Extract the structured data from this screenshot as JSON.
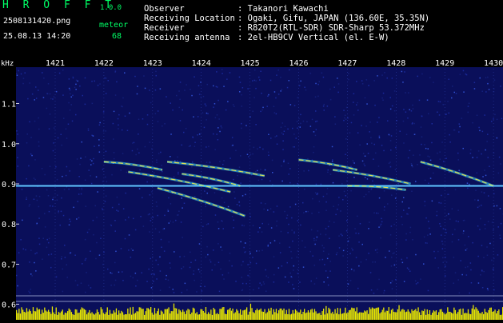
{
  "app": {
    "name": "H R O F F T",
    "version": "1.0.0"
  },
  "file": {
    "name": "2508131420.png",
    "datetime": "25.08.13 14:20"
  },
  "counter": {
    "label": "meteor",
    "value": "68"
  },
  "station": [
    {
      "label": "Observer",
      "value": ": Takanori Kawachi"
    },
    {
      "label": "Receiving Location",
      "value": ": Ogaki, Gifu, JAPAN (136.60E, 35.35N)"
    },
    {
      "label": "Receiver",
      "value": ": R820T2(RTL-SDR) SDR-Sharp 53.372MHz"
    },
    {
      "label": "Receiving antenna",
      "value": ": 2el-HB9CV Vertical (el. E-W)"
    }
  ],
  "chart_data": {
    "type": "heatmap",
    "ylabel": "kHz",
    "x_ticks": [
      "1421",
      "1422",
      "1423",
      "1424",
      "1425",
      "1426",
      "1427",
      "1428",
      "1429",
      "1430"
    ],
    "y_ticks": [
      "1.1",
      "1.0",
      "0.9",
      "0.8",
      "0.7",
      "0.6"
    ],
    "ylim": [
      0.6,
      1.12
    ],
    "carrier_khz": 0.895,
    "traces": [
      {
        "x": [
          1422.0,
          1423.2
        ],
        "y": [
          0.955,
          0.935
        ]
      },
      {
        "x": [
          1422.5,
          1424.6
        ],
        "y": [
          0.93,
          0.88
        ]
      },
      {
        "x": [
          1423.3,
          1425.3
        ],
        "y": [
          0.955,
          0.92
        ]
      },
      {
        "x": [
          1423.6,
          1424.8
        ],
        "y": [
          0.925,
          0.895
        ]
      },
      {
        "x": [
          1423.1,
          1424.9
        ],
        "y": [
          0.89,
          0.82
        ]
      },
      {
        "x": [
          1426.0,
          1427.2
        ],
        "y": [
          0.96,
          0.935
        ]
      },
      {
        "x": [
          1426.7,
          1428.3
        ],
        "y": [
          0.935,
          0.9
        ]
      },
      {
        "x": [
          1427.0,
          1428.2
        ],
        "y": [
          0.895,
          0.885
        ]
      },
      {
        "x": [
          1428.5,
          1430.0
        ],
        "y": [
          0.955,
          0.895
        ]
      }
    ],
    "colors": {
      "background": "#0a0f5a",
      "carrier": "#40b8ff",
      "trace_hot": "#ffee40",
      "trace_mid": "#40e0ff",
      "signal_bar": "#e8e800"
    }
  }
}
